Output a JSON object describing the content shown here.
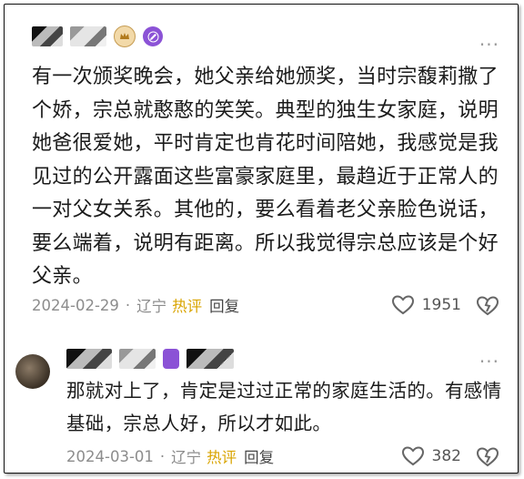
{
  "comments": [
    {
      "username_obscured": "",
      "text": "有一次颁奖晚会，她父亲给她颁奖，当时宗馥莉撒了个娇，宗总就憨憨的笑笑。典型的独生女家庭，说明她爸很爱她，平时肯定也肯花时间陪她，我感觉是我见过的公开露面这些富豪家庭里，最趋近于正常人的一对父女关系。其他的，要么看着老父亲脸色说话，要么端着，说明有距离。所以我觉得宗总应该是个好父亲。",
      "date": "2024-02-29",
      "location": "辽宁",
      "hot_label": "热评",
      "reply_label": "回复",
      "likes": "1951"
    },
    {
      "username_obscured": "",
      "text": "那就对上了，肯定是过过正常的家庭生活的。有感情基础，宗总人好，所以才如此。",
      "date": "2024-03-01",
      "location": "辽宁",
      "hot_label": "热评",
      "reply_label": "回复",
      "likes": "382"
    }
  ],
  "icons": {
    "more": "more-dots-icon",
    "like": "heart-icon",
    "dislike": "broken-heart-icon",
    "level_badge": "crown-badge-icon",
    "vip_badge": "edit-badge-icon"
  },
  "colors": {
    "hot_label": "#d9a400",
    "badge_purple": "#8b52d6",
    "meta": "#8c8c8c"
  },
  "more_glyph": "···"
}
